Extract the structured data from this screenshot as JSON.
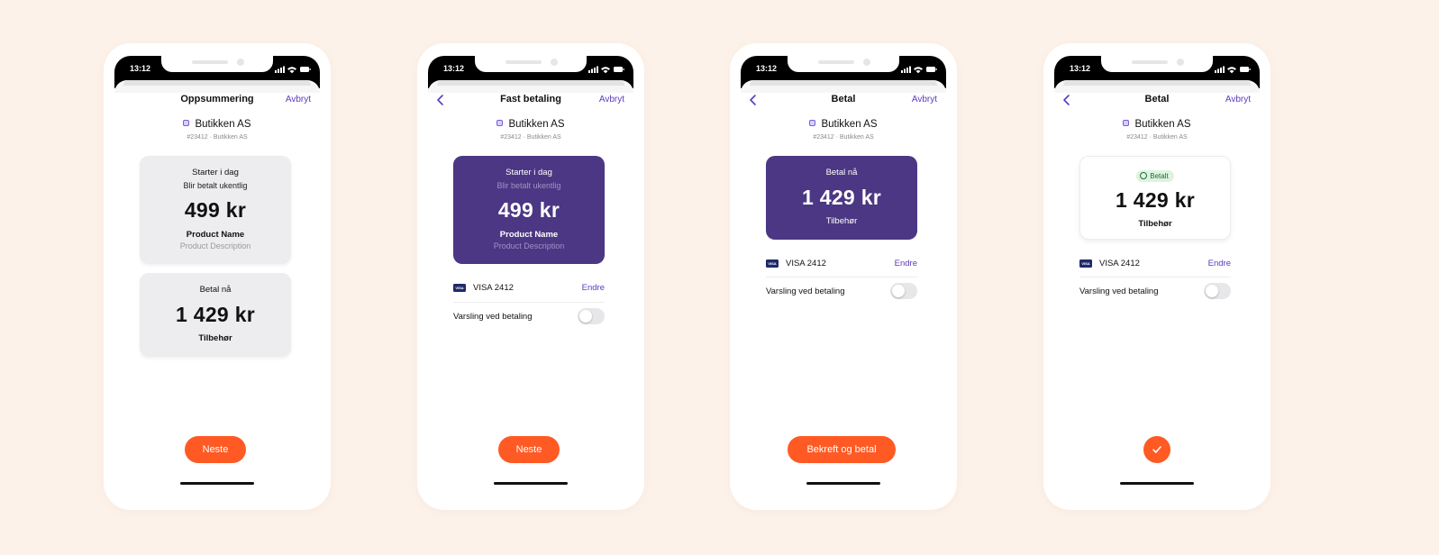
{
  "colors": {
    "accent": "#ff5a24",
    "purple": "#4b3784",
    "link": "#5b3bbf",
    "background": "#fdf2e9"
  },
  "icons": {
    "status": [
      "signal-icon",
      "wifi-icon",
      "battery-icon"
    ],
    "back": "chevron-left-icon",
    "merchant": "merchant-logo-icon",
    "card": "visa-card-icon",
    "paid": "check-circle-icon",
    "done": "checkmark-icon"
  },
  "screens": [
    {
      "time": "13:12",
      "nav": {
        "title": "Oppsummering",
        "cancel": "Avbryt"
      },
      "merchant": {
        "name": "Butikken AS",
        "sub": "#23412 · Butikken AS"
      },
      "subscription_card": {
        "line1": "Starter i dag",
        "line2": "Blir betalt ukentlig",
        "amount": "499 kr",
        "product_name": "Product Name",
        "product_description": "Product Description"
      },
      "pay_card": {
        "line1": "Betal nå",
        "amount": "1 429 kr",
        "sub": "Tilbehør"
      },
      "cta": "Neste"
    },
    {
      "time": "13:12",
      "nav": {
        "title": "Fast betaling",
        "cancel": "Avbryt"
      },
      "merchant": {
        "name": "Butikken AS",
        "sub": "#23412 · Butikken AS"
      },
      "subscription_card": {
        "line1": "Starter i dag",
        "line2": "Blir betalt ukentlig",
        "amount": "499 kr",
        "product_name": "Product Name",
        "product_description": "Product Description"
      },
      "payment_method": {
        "card_brand": "VISA",
        "label": "VISA 2412",
        "change": "Endre"
      },
      "notify": {
        "label": "Varsling ved betaling",
        "enabled": false
      },
      "cta": "Neste"
    },
    {
      "time": "13:12",
      "nav": {
        "title": "Betal",
        "cancel": "Avbryt"
      },
      "merchant": {
        "name": "Butikken AS",
        "sub": "#23412 · Butikken AS"
      },
      "pay_card": {
        "line1": "Betal nå",
        "amount": "1 429 kr",
        "sub": "Tilbehør"
      },
      "payment_method": {
        "card_brand": "VISA",
        "label": "VISA 2412",
        "change": "Endre"
      },
      "notify": {
        "label": "Varsling ved betaling",
        "enabled": false
      },
      "cta": "Bekreft og betal"
    },
    {
      "time": "13:12",
      "nav": {
        "title": "Betal",
        "cancel": "Avbryt"
      },
      "merchant": {
        "name": "Butikken AS",
        "sub": "#23412 · Butikken AS"
      },
      "pay_card": {
        "badge": "Betalt",
        "amount": "1 429 kr",
        "sub": "Tilbehør"
      },
      "payment_method": {
        "card_brand": "VISA",
        "label": "VISA 2412",
        "change": "Endre"
      },
      "notify": {
        "label": "Varsling ved betaling",
        "enabled": false
      }
    }
  ]
}
